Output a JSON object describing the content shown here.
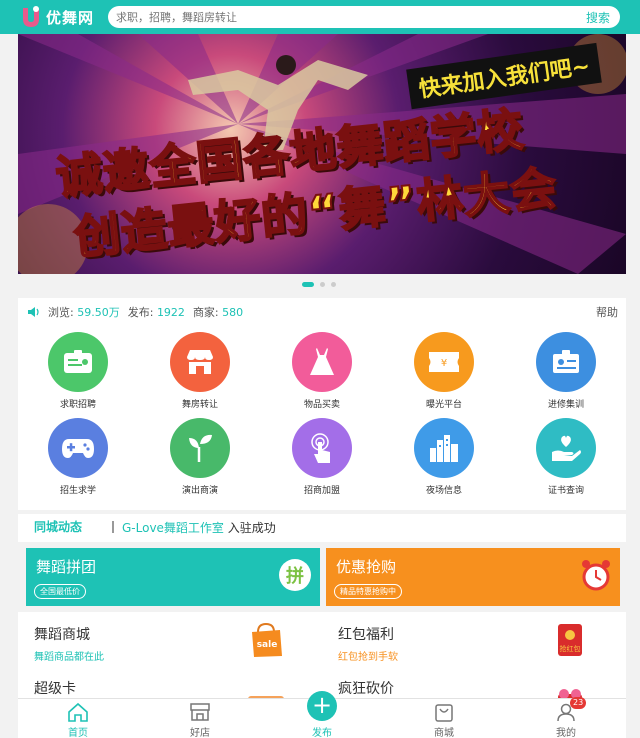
{
  "header": {
    "logo_text": "优舞网",
    "search_placeholder": "求职，招聘，舞蹈房转让",
    "search_button": "搜索"
  },
  "banner": {
    "slogan": "快来加入我们吧~",
    "line1": "诚邀全国各地舞蹈学校",
    "line2": "创造最好的“舞”林大会"
  },
  "stats": {
    "views_label": "浏览:",
    "views_value": "59.50万",
    "posts_label": "发布:",
    "posts_value": "1922",
    "merchants_label": "商家:",
    "merchants_value": "580",
    "help": "帮助"
  },
  "categories": [
    {
      "label": "求职招聘",
      "color": "#4cc76a",
      "icon": "id-card-icon"
    },
    {
      "label": "舞房转让",
      "color": "#f3623e",
      "icon": "shop-icon"
    },
    {
      "label": "物品买卖",
      "color": "#f25c9a",
      "icon": "dress-icon"
    },
    {
      "label": "曝光平台",
      "color": "#f79a1e",
      "icon": "ticket-icon"
    },
    {
      "label": "进修集训",
      "color": "#3d8fe0",
      "icon": "badge-icon"
    },
    {
      "label": "招生求学",
      "color": "#5a7fe0",
      "icon": "gamepad-icon"
    },
    {
      "label": "演出商演",
      "color": "#48b96a",
      "icon": "sprout-icon"
    },
    {
      "label": "招商加盟",
      "color": "#a36ee8",
      "icon": "touch-icon"
    },
    {
      "label": "夜场信息",
      "color": "#3f9be8",
      "icon": "city-icon"
    },
    {
      "label": "证书查询",
      "color": "#2fbcc4",
      "icon": "hand-heart-icon"
    }
  ],
  "dynamics": {
    "title": "同城动态",
    "highlight": "G-Love舞蹈工作室",
    "text": "入驻成功"
  },
  "promos": [
    {
      "title": "舞蹈拼团",
      "tag": "全国最低价",
      "color": "#1ec2b5",
      "icon": "pin-icon",
      "icon_text": "拼"
    },
    {
      "title": "优惠抢购",
      "tag": "精品特惠抢购中",
      "color": "#f7901e",
      "icon": "alarm-clock-icon"
    }
  ],
  "shop": [
    {
      "title": "舞蹈商城",
      "subtitle": "舞蹈商品都在此",
      "sub_color": "#1ec2b5",
      "img": "sale-bag-icon",
      "img_text": "sale"
    },
    {
      "title": "红包福利",
      "subtitle": "红包抢到手软",
      "sub_color": "#f7901e",
      "img": "red-envelope-icon",
      "img_text": "抢红包"
    },
    {
      "title": "超级卡",
      "subtitle": "",
      "sub_color": "#1ec2b5",
      "img": "card-icon"
    },
    {
      "title": "疯狂砍价",
      "subtitle": "",
      "sub_color": "#f7901e",
      "img": "bargain-icon"
    }
  ],
  "nav": {
    "home": "首页",
    "shops": "好店",
    "publish": "发布",
    "mall": "商城",
    "mine": "我的",
    "mine_badge": "23"
  }
}
